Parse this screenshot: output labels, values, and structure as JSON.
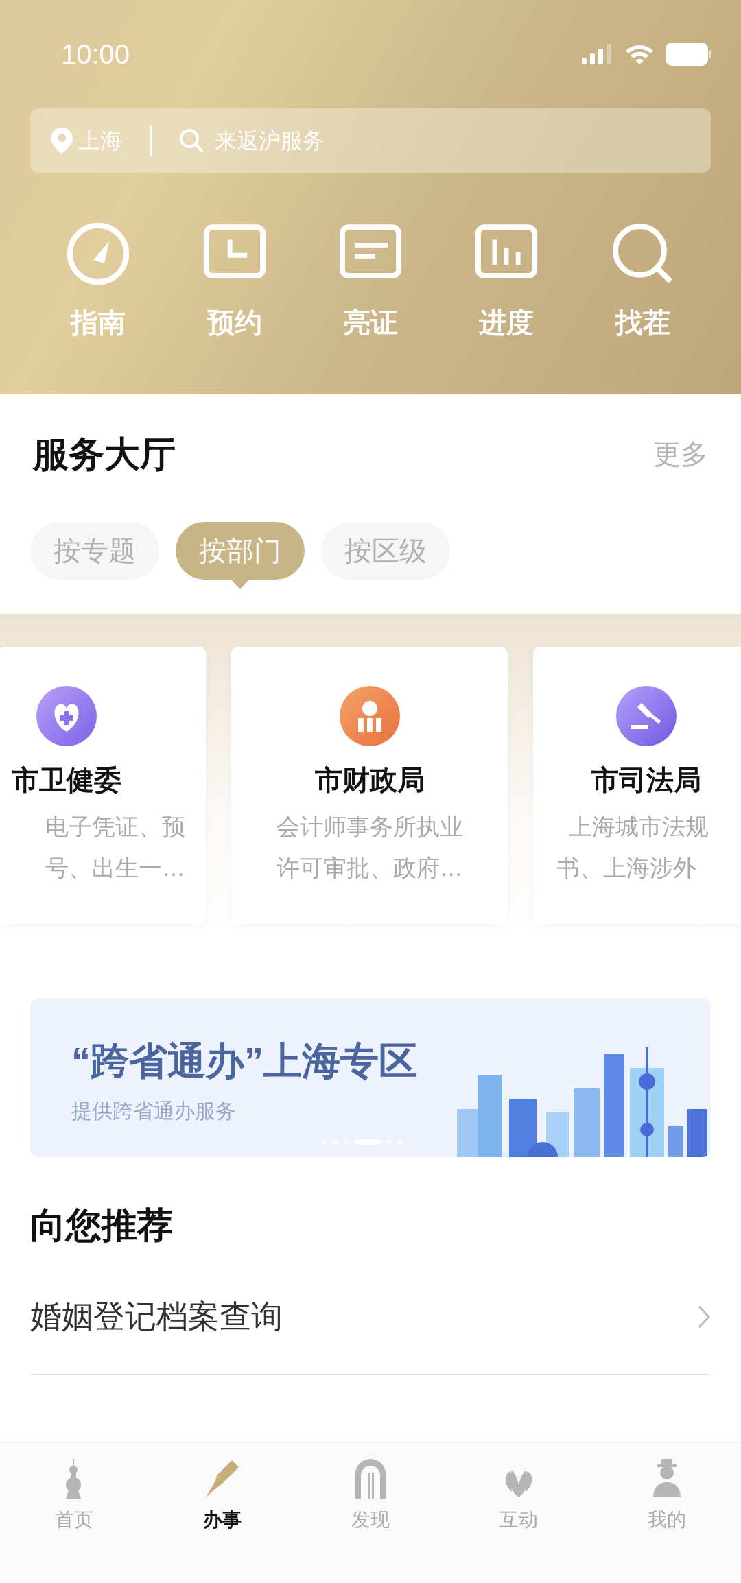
{
  "status_bar": {
    "time": "10:00"
  },
  "search": {
    "city": "上海",
    "placeholder": "来返沪服务"
  },
  "quick_actions": [
    {
      "label": "指南",
      "kind": "gauge"
    },
    {
      "label": "预约",
      "kind": "clock"
    },
    {
      "label": "亮证",
      "kind": "card"
    },
    {
      "label": "进度",
      "kind": "chart"
    },
    {
      "label": "找茬",
      "kind": "search"
    }
  ],
  "service_hall": {
    "title": "服务大厅",
    "more": "更多",
    "tabs": [
      {
        "label": "按专题",
        "selected": false
      },
      {
        "label": "按部门",
        "selected": true
      },
      {
        "label": "按区级",
        "selected": false
      }
    ],
    "cards": [
      {
        "name": "市卫健委",
        "kind": "heart",
        "lines": [
          "电子凭证、预",
          "号、出生一…"
        ]
      },
      {
        "name": "市财政局",
        "kind": "money",
        "lines": [
          "会计师事务所执业",
          "许可审批、政府…"
        ]
      },
      {
        "name": "市司法局",
        "kind": "gavel",
        "lines": [
          "上海城市法规",
          "书、上海涉外"
        ]
      }
    ]
  },
  "banner": {
    "title": "“跨省通办”上海专区",
    "subtitle": "提供跨省通办服务",
    "dots": [
      {
        "selected": false
      },
      {
        "selected": false
      },
      {
        "selected": false
      },
      {
        "selected": true
      },
      {
        "selected": false
      },
      {
        "selected": false
      }
    ]
  },
  "recommend": {
    "title": "向您推荐",
    "items": [
      "婚姻登记档案查询"
    ]
  },
  "tab_bar": [
    {
      "label": "首页",
      "kind": "tower",
      "selected": false
    },
    {
      "label": "办事",
      "kind": "pen",
      "selected": true
    },
    {
      "label": "发现",
      "kind": "arch",
      "selected": false
    },
    {
      "label": "互动",
      "kind": "flower",
      "selected": false
    },
    {
      "label": "我的",
      "kind": "person",
      "selected": false
    }
  ]
}
